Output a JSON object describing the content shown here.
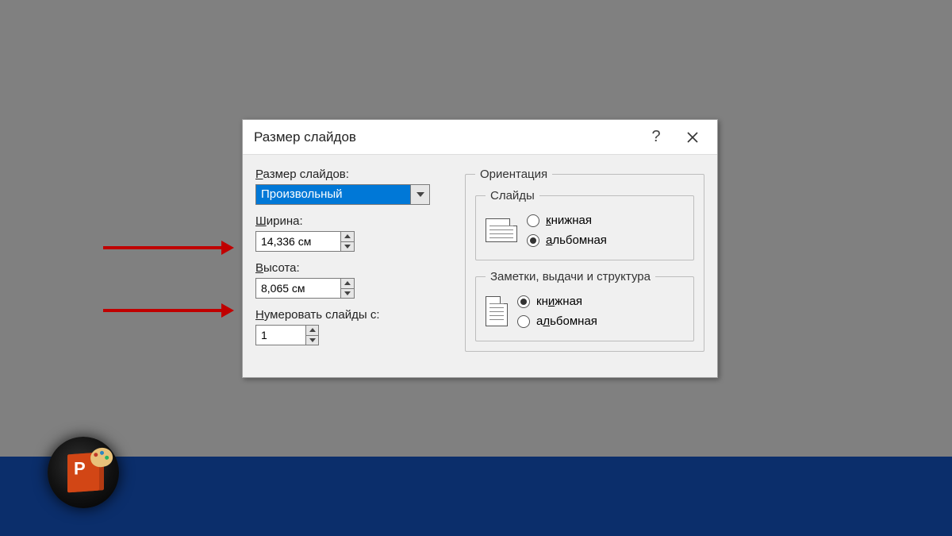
{
  "dialog": {
    "title": "Размер слайдов",
    "slide_size_label": "Размер слайдов:",
    "slide_size_value": "Произвольный",
    "width_label": "Ширина:",
    "width_value": "14,336 см",
    "height_label": "Высота:",
    "height_value": "8,065 см",
    "number_from_label": "Нумеровать слайды с:",
    "number_from_value": "1",
    "orientation_legend": "Ориентация",
    "slides_legend": "Слайды",
    "notes_legend": "Заметки, выдачи и структура",
    "portrait_label": "книжная",
    "landscape_label": "альбомная",
    "slides_selected": "landscape",
    "notes_selected": "portrait"
  }
}
